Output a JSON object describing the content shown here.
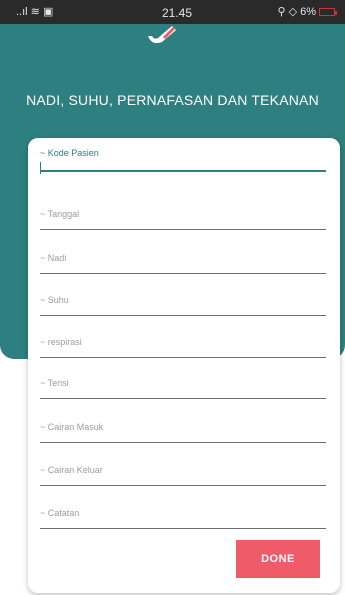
{
  "status_bar": {
    "left_icons": "..ıl ≋ ▣",
    "time": "21.45",
    "right_icons": "⚲ ◇",
    "battery": "6%"
  },
  "header": {
    "title": "NADI, SUHU, PERNAFASAN DAN TEKANAN",
    "logo_icon": "thermometer-icon",
    "background_color": "#2e7f80"
  },
  "form": {
    "fields": [
      {
        "label": "~ Kode Pasien",
        "active": true
      },
      {
        "label": "~ Tanggal"
      },
      {
        "label": "~ Nadi"
      },
      {
        "label": "~ Suhu"
      },
      {
        "label": "~ respirasi"
      },
      {
        "label": "~ Tensi"
      },
      {
        "label": "~ Cairan Masuk"
      },
      {
        "label": "~ Cairan Keluar"
      },
      {
        "label": "~ Catatan"
      }
    ],
    "done_label": "DONE",
    "done_color": "#f05b6a"
  }
}
